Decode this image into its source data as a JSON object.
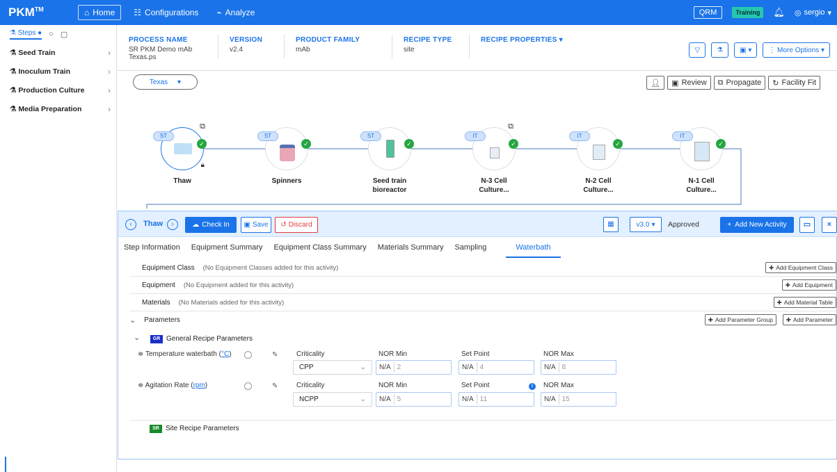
{
  "app": {
    "logo": "PKM",
    "logo_sup": "TM"
  },
  "topnav": {
    "home": "Home",
    "configurations": "Configurations",
    "analyze": "Analyze"
  },
  "topright": {
    "qrm": "QRM",
    "training": "Training",
    "user": "sergio"
  },
  "sidebar": {
    "tabs": {
      "steps": "Steps"
    },
    "items": [
      {
        "label": "Seed Train"
      },
      {
        "label": "Inoculum Train"
      },
      {
        "label": "Production Culture"
      },
      {
        "label": "Media Preparation"
      }
    ]
  },
  "process": {
    "name_label": "PROCESS NAME",
    "name_value": "SR PKM Demo mAb Texas.ps",
    "version_label": "VERSION",
    "version_value": "v2.4",
    "family_label": "PRODUCT FAMILY",
    "family_value": "mAb",
    "recipe_type_label": "RECIPE TYPE",
    "recipe_type_value": "site",
    "recipe_props_label": "RECIPE PROPERTIES",
    "more_options": "More Options"
  },
  "site_select": {
    "value": "Texas"
  },
  "actions": {
    "review": "Review",
    "propagate": "Propagate",
    "facility_fit": "Facility Fit"
  },
  "flow": {
    "nodes": [
      {
        "chip": "ST",
        "label1": "Thaw",
        "label2": ""
      },
      {
        "chip": "ST",
        "label1": "Spinners",
        "label2": ""
      },
      {
        "chip": "ST",
        "label1": "Seed train",
        "label2": "bioreactor"
      },
      {
        "chip": "IT",
        "label1": "N-3 Cell",
        "label2": "Culture..."
      },
      {
        "chip": "IT",
        "label1": "N-2 Cell",
        "label2": "Culture..."
      },
      {
        "chip": "IT",
        "label1": "N-1 Cell",
        "label2": "Culture..."
      }
    ]
  },
  "panel": {
    "title": "Thaw",
    "check_in": "Check In",
    "save": "Save",
    "discard": "Discard",
    "version": "v3.0",
    "status": "Approved",
    "add_activity": "Add New Activity",
    "tabs": [
      "Step Information",
      "Equipment Summary",
      "Equipment Class Summary",
      "Materials Summary",
      "Sampling",
      "Waterbath"
    ],
    "rows": [
      {
        "label": "Equipment Class",
        "msg": "(No Equipment Classes added for this activity)",
        "btn": "Add Equipment Class"
      },
      {
        "label": "Equipment",
        "msg": "(No Equipment added for this activity)",
        "btn": "Add Equipment"
      },
      {
        "label": "Materials",
        "msg": "(No Materials added for this activity)",
        "btn": "Add Material Table"
      }
    ],
    "parameters": {
      "label": "Parameters",
      "add_group": "Add Parameter Group",
      "add_param": "Add Parameter"
    },
    "general": {
      "badge": "GR",
      "label": "General Recipe Parameters"
    },
    "site": {
      "badge": "SR",
      "label": "Site Recipe Parameters"
    },
    "params": [
      {
        "name": "Temperature waterbath",
        "unit": "°C",
        "criticality": "CPP",
        "nor_min": "2",
        "set_point": "4",
        "nor_max": "8"
      },
      {
        "name": "Agitation Rate",
        "unit": "rpm",
        "criticality": "NCPP",
        "nor_min": "5",
        "set_point": "11",
        "nor_max": "15"
      }
    ],
    "col_labels": {
      "criticality": "Criticality",
      "nor_min": "NOR Min",
      "set_point": "Set Point",
      "nor_max": "NOR Max",
      "na": "N/A"
    }
  },
  "colors": {
    "primary": "#1a73e8",
    "success": "#26a641",
    "danger": "#e23c3c",
    "training": "#27c6b0"
  }
}
